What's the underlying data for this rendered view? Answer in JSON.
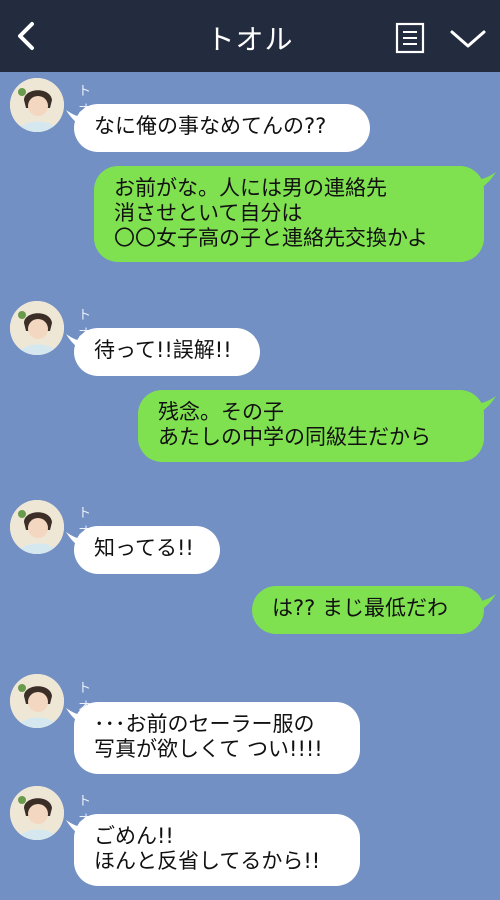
{
  "header": {
    "title": "トオル",
    "back_icon": "chevron-left-icon",
    "menu_icon": "list-menu-icon",
    "expand_icon": "chevron-down-icon",
    "bg_color": "#232b3e"
  },
  "chat": {
    "bg_color": "#7290c4",
    "incoming_color": "#ffffff",
    "outgoing_color": "#7fe14f",
    "messages": [
      {
        "sender": "トオル",
        "direction": "incoming",
        "text": "なに俺の事なめてんの??"
      },
      {
        "sender": "",
        "direction": "outgoing",
        "text": "お前がな。人には男の連絡先\n消させといて自分は\n〇〇女子高の子と連絡先交換かよ"
      },
      {
        "sender": "トオル",
        "direction": "incoming",
        "text": "待って!!誤解!!"
      },
      {
        "sender": "",
        "direction": "outgoing",
        "text": "残念。その子\nあたしの中学の同級生だから"
      },
      {
        "sender": "トオル",
        "direction": "incoming",
        "text": "知ってる!!"
      },
      {
        "sender": "",
        "direction": "outgoing",
        "text": "は?? まじ最低だわ"
      },
      {
        "sender": "トオル",
        "direction": "incoming",
        "text": "･･･お前のセーラー服の\n写真が欲しくて つい!!!!"
      },
      {
        "sender": "トオル",
        "direction": "incoming",
        "text": "ごめん!!\nほんと反省してるから!!"
      }
    ]
  }
}
